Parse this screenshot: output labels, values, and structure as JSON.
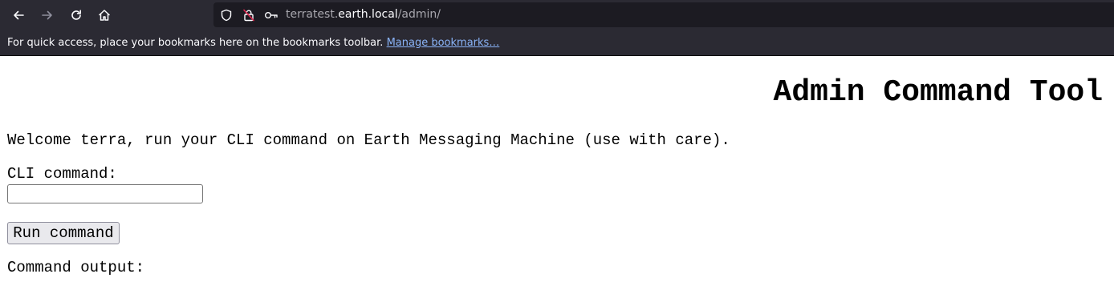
{
  "browser": {
    "icons": {
      "back": "arrow-left-icon",
      "forward": "arrow-right-icon",
      "reload": "reload-icon",
      "home": "home-icon",
      "tracking_protection": "shield-icon",
      "connection": "insecure-lock-icon",
      "permissions": "key-icon"
    },
    "url": {
      "prefix": "terratest.",
      "host": "earth.local",
      "path": "/admin/"
    },
    "bookmarks_bar": {
      "message": "For quick access, place your bookmarks here on the bookmarks toolbar.",
      "link": "Manage bookmarks…"
    },
    "colors": {
      "toolbar": "#2b2a33",
      "urlbar": "#1c1b22",
      "link": "#8ab4f8",
      "insecure_accent": "#e22850"
    }
  },
  "page": {
    "title": "Admin Command Tool",
    "welcome": "Welcome terra, run your CLI command on Earth Messaging Machine (use with care).",
    "cli_label": "CLI command:",
    "cli_value": "",
    "run_button": "Run command",
    "output_label": "Command output:"
  }
}
